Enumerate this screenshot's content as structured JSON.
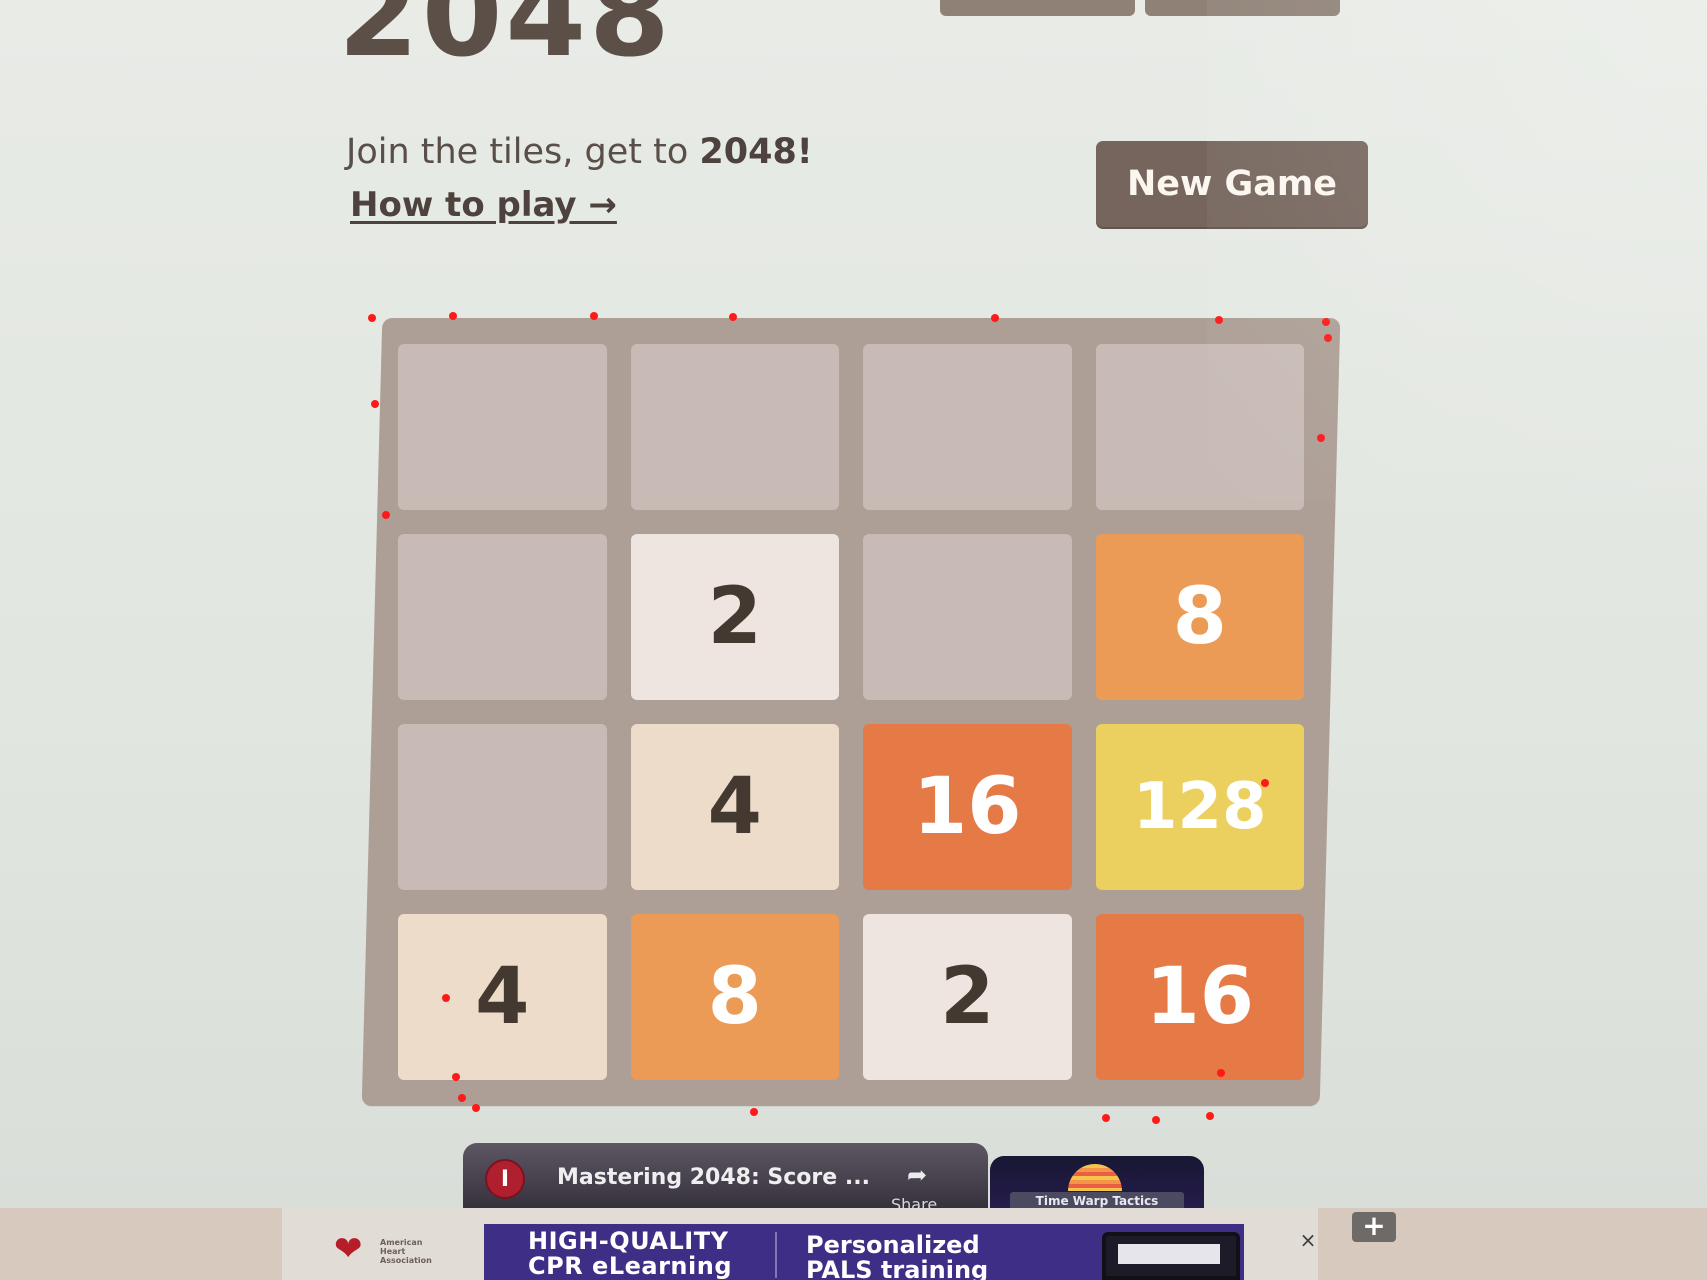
{
  "header": {
    "title": "2048",
    "subtitle_prefix": "Join the tiles, get to ",
    "subtitle_highlight": "2048!",
    "how_to_play": "How to play →",
    "new_game_label": "New Game"
  },
  "board": {
    "rows": [
      [
        "",
        "",
        "",
        ""
      ],
      [
        "",
        "2",
        "",
        "8"
      ],
      [
        "",
        "4",
        "16",
        "128"
      ],
      [
        "4",
        "8",
        "2",
        "16"
      ]
    ]
  },
  "video": {
    "channel_icon": "I",
    "title": "Mastering 2048: Score ...",
    "share_label": "Share",
    "share_icon": "share-icon"
  },
  "side_video": {
    "label": "Time Warp Tactics"
  },
  "ad": {
    "left_text_line1": "HIGH-QUALITY",
    "left_text_line2": "CPR eLearning",
    "right_text_line1": "Personalized",
    "right_text_line2": "PALS training",
    "close_icon": "×",
    "expand_icon": "+"
  },
  "colors": {
    "empty_tile": "#c8bbb5",
    "tile_2": "#eee5e1",
    "tile_4": "#ecdcc9",
    "tile_8": "#ec9b57",
    "tile_16": "#e57a46",
    "tile_128": "#ebcf5f",
    "board_bg": "#ad9f96",
    "new_game_bg": "#75655d"
  }
}
